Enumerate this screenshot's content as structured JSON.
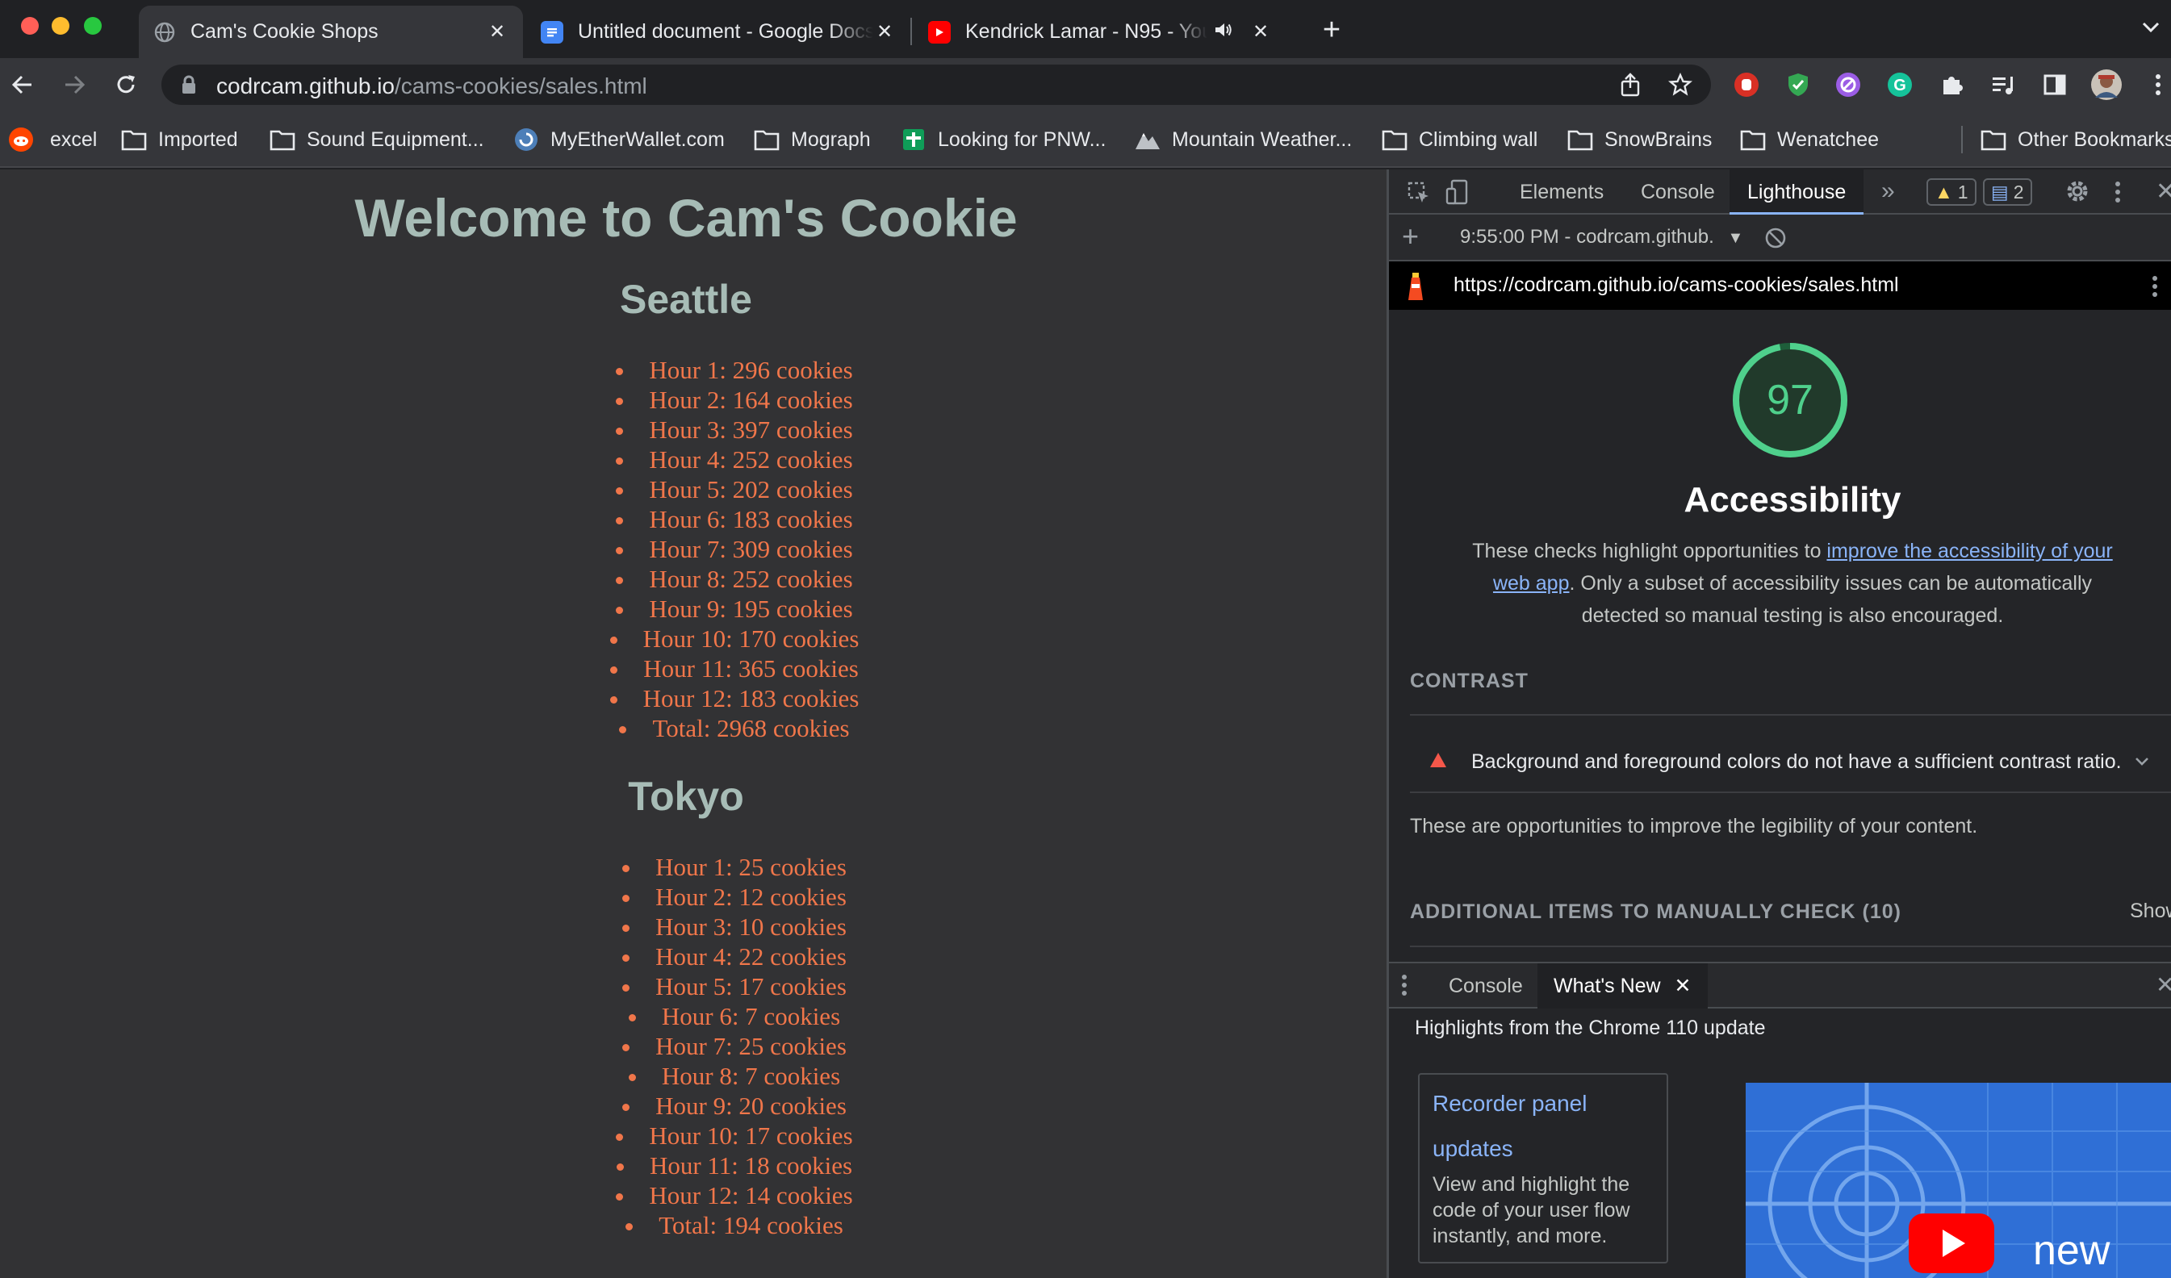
{
  "browser": {
    "tabs": [
      {
        "title": "Cam's Cookie Shops",
        "active": true
      },
      {
        "title": "Untitled document - Google Docs",
        "active": false
      },
      {
        "title": "Kendrick Lamar - N95 - YouTube",
        "active": false
      }
    ],
    "url_host": "codrcam.github.io",
    "url_path": "/cams-cookies/sales.html",
    "bookmarks": [
      {
        "label": "excel",
        "icon": "reddit-icon"
      },
      {
        "label": "Imported",
        "icon": "folder-icon"
      },
      {
        "label": "Sound Equipment...",
        "icon": "folder-icon"
      },
      {
        "label": "MyEtherWallet.com",
        "icon": "mew-icon"
      },
      {
        "label": "Mograph",
        "icon": "folder-icon"
      },
      {
        "label": "Looking for PNW...",
        "icon": "sheets-icon"
      },
      {
        "label": "Mountain Weather...",
        "icon": "mountain-icon"
      },
      {
        "label": "Climbing wall",
        "icon": "folder-icon"
      },
      {
        "label": "SnowBrains",
        "icon": "folder-icon"
      },
      {
        "label": "Wenatchee",
        "icon": "folder-icon"
      },
      {
        "label": "Other Bookmarks",
        "icon": "folder-icon"
      }
    ]
  },
  "page": {
    "title": "Welcome to Cam's Cookie",
    "stores": [
      {
        "city": "Seattle",
        "items": [
          "Hour 1: 296 cookies",
          "Hour 2: 164 cookies",
          "Hour 3: 397 cookies",
          "Hour 4: 252 cookies",
          "Hour 5: 202 cookies",
          "Hour 6: 183 cookies",
          "Hour 7: 309 cookies",
          "Hour 8: 252 cookies",
          "Hour 9: 195 cookies",
          "Hour 10: 170 cookies",
          "Hour 11: 365 cookies",
          "Hour 12: 183 cookies",
          "Total: 2968 cookies"
        ]
      },
      {
        "city": "Tokyo",
        "items": [
          "Hour 1: 25 cookies",
          "Hour 2: 12 cookies",
          "Hour 3: 10 cookies",
          "Hour 4: 22 cookies",
          "Hour 5: 17 cookies",
          "Hour 6: 7 cookies",
          "Hour 7: 25 cookies",
          "Hour 8: 7 cookies",
          "Hour 9: 20 cookies",
          "Hour 10: 17 cookies",
          "Hour 11: 18 cookies",
          "Hour 12: 14 cookies",
          "Total: 194 cookies"
        ]
      }
    ]
  },
  "devtools": {
    "tabs": [
      "Elements",
      "Console",
      "Lighthouse"
    ],
    "warning_count": "1",
    "message_count": "2",
    "report_selector": "9:55:00 PM - codrcam.github.",
    "report_url": "https://codrcam.github.io/cams-cookies/sales.html",
    "score": "97",
    "category": "Accessibility",
    "desc_before": "These checks highlight opportunities to ",
    "desc_link": "improve the accessibility of your web app",
    "desc_after": ". Only a subset of accessibility issues can be automatically detected so manual testing is also encouraged.",
    "contrast_heading": "CONTRAST",
    "contrast_audit": "Background and foreground colors do not have a sufficient contrast ratio.",
    "contrast_note": "These are opportunities to improve the legibility of your content.",
    "manual_heading": "ADDITIONAL ITEMS TO MANUALLY CHECK (10)",
    "manual_show": "Show",
    "drawer_tabs": [
      "Console",
      "What's New"
    ],
    "whatsnew_heading": "Highlights from the Chrome 110 update",
    "card_title": "Recorder panel updates",
    "card_body": "View and highlight the code of your user flow instantly, and more.",
    "thumb_label": "new"
  },
  "colors": {
    "page_bg": "#323234",
    "heading": "#a7bcb6",
    "list_text": "#f0764a",
    "score_green": "#4fd08c",
    "link": "#8ab4f8"
  }
}
